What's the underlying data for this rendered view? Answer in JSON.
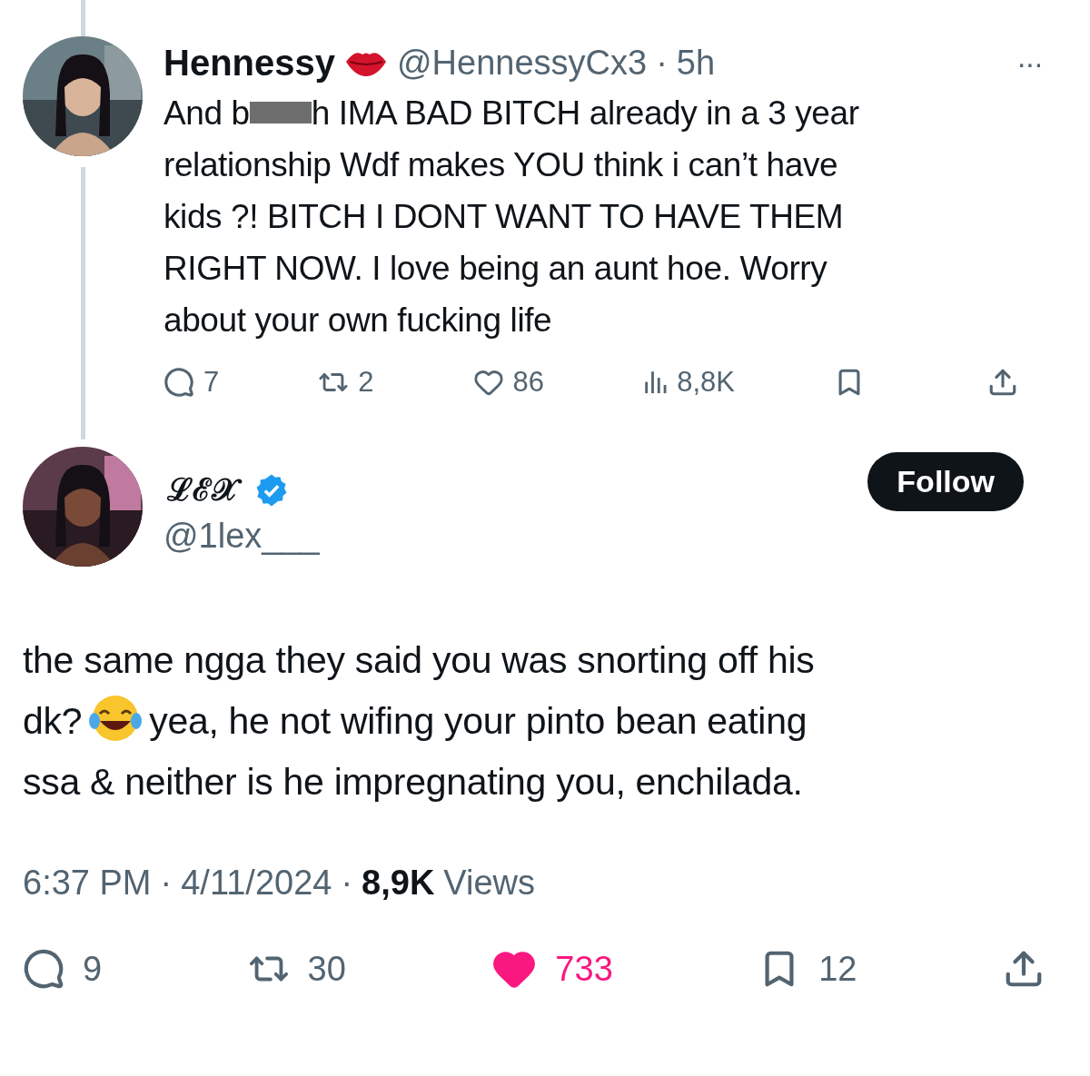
{
  "parent_post": {
    "name": "Hennessy",
    "handle": "@HennessyCx3",
    "separator": "·",
    "time": "5h",
    "more": "···",
    "text_before": "And b",
    "redacted": true,
    "text_after": "h IMA BAD BITCH already in a 3 year",
    "text_lines": [
      "relationship Wdf makes YOU think i can’t have",
      "kids ?! BITCH I DONT WANT TO HAVE THEM",
      "RIGHT NOW. I love being an aunt hoe. Worry",
      "about your own fucking life"
    ],
    "liked": false,
    "actions": [
      {
        "kind": "reply",
        "count": "7"
      },
      {
        "kind": "repost",
        "count": "2"
      },
      {
        "kind": "like",
        "count": "86"
      },
      {
        "kind": "views",
        "count": "8,8K"
      },
      {
        "kind": "bookmark"
      },
      {
        "kind": "share"
      }
    ]
  },
  "post": {
    "name": "ℒℰ𝒳",
    "verified": true,
    "handle": "@1lex___",
    "follow_label": "Follow",
    "text_lines": [
      {
        "before": "the same ngga they said you was snorting off his"
      },
      {
        "before": "dk?",
        "emoji": true,
        "after": "yea, he not wifing your pinto bean eating"
      },
      {
        "before": "ssa & neither is he impregnating you, enchilada."
      }
    ],
    "time": "6:37 PM",
    "separator1": "·",
    "date": "4/11/2024",
    "separator2": "·",
    "views_count": "8,9K",
    "views_label": "Views",
    "liked": true,
    "actions": [
      {
        "kind": "reply",
        "count": "9"
      },
      {
        "kind": "repost",
        "count": "30"
      },
      {
        "kind": "like",
        "count": "733"
      },
      {
        "kind": "bookmark",
        "count": "12"
      },
      {
        "kind": "share"
      }
    ]
  }
}
